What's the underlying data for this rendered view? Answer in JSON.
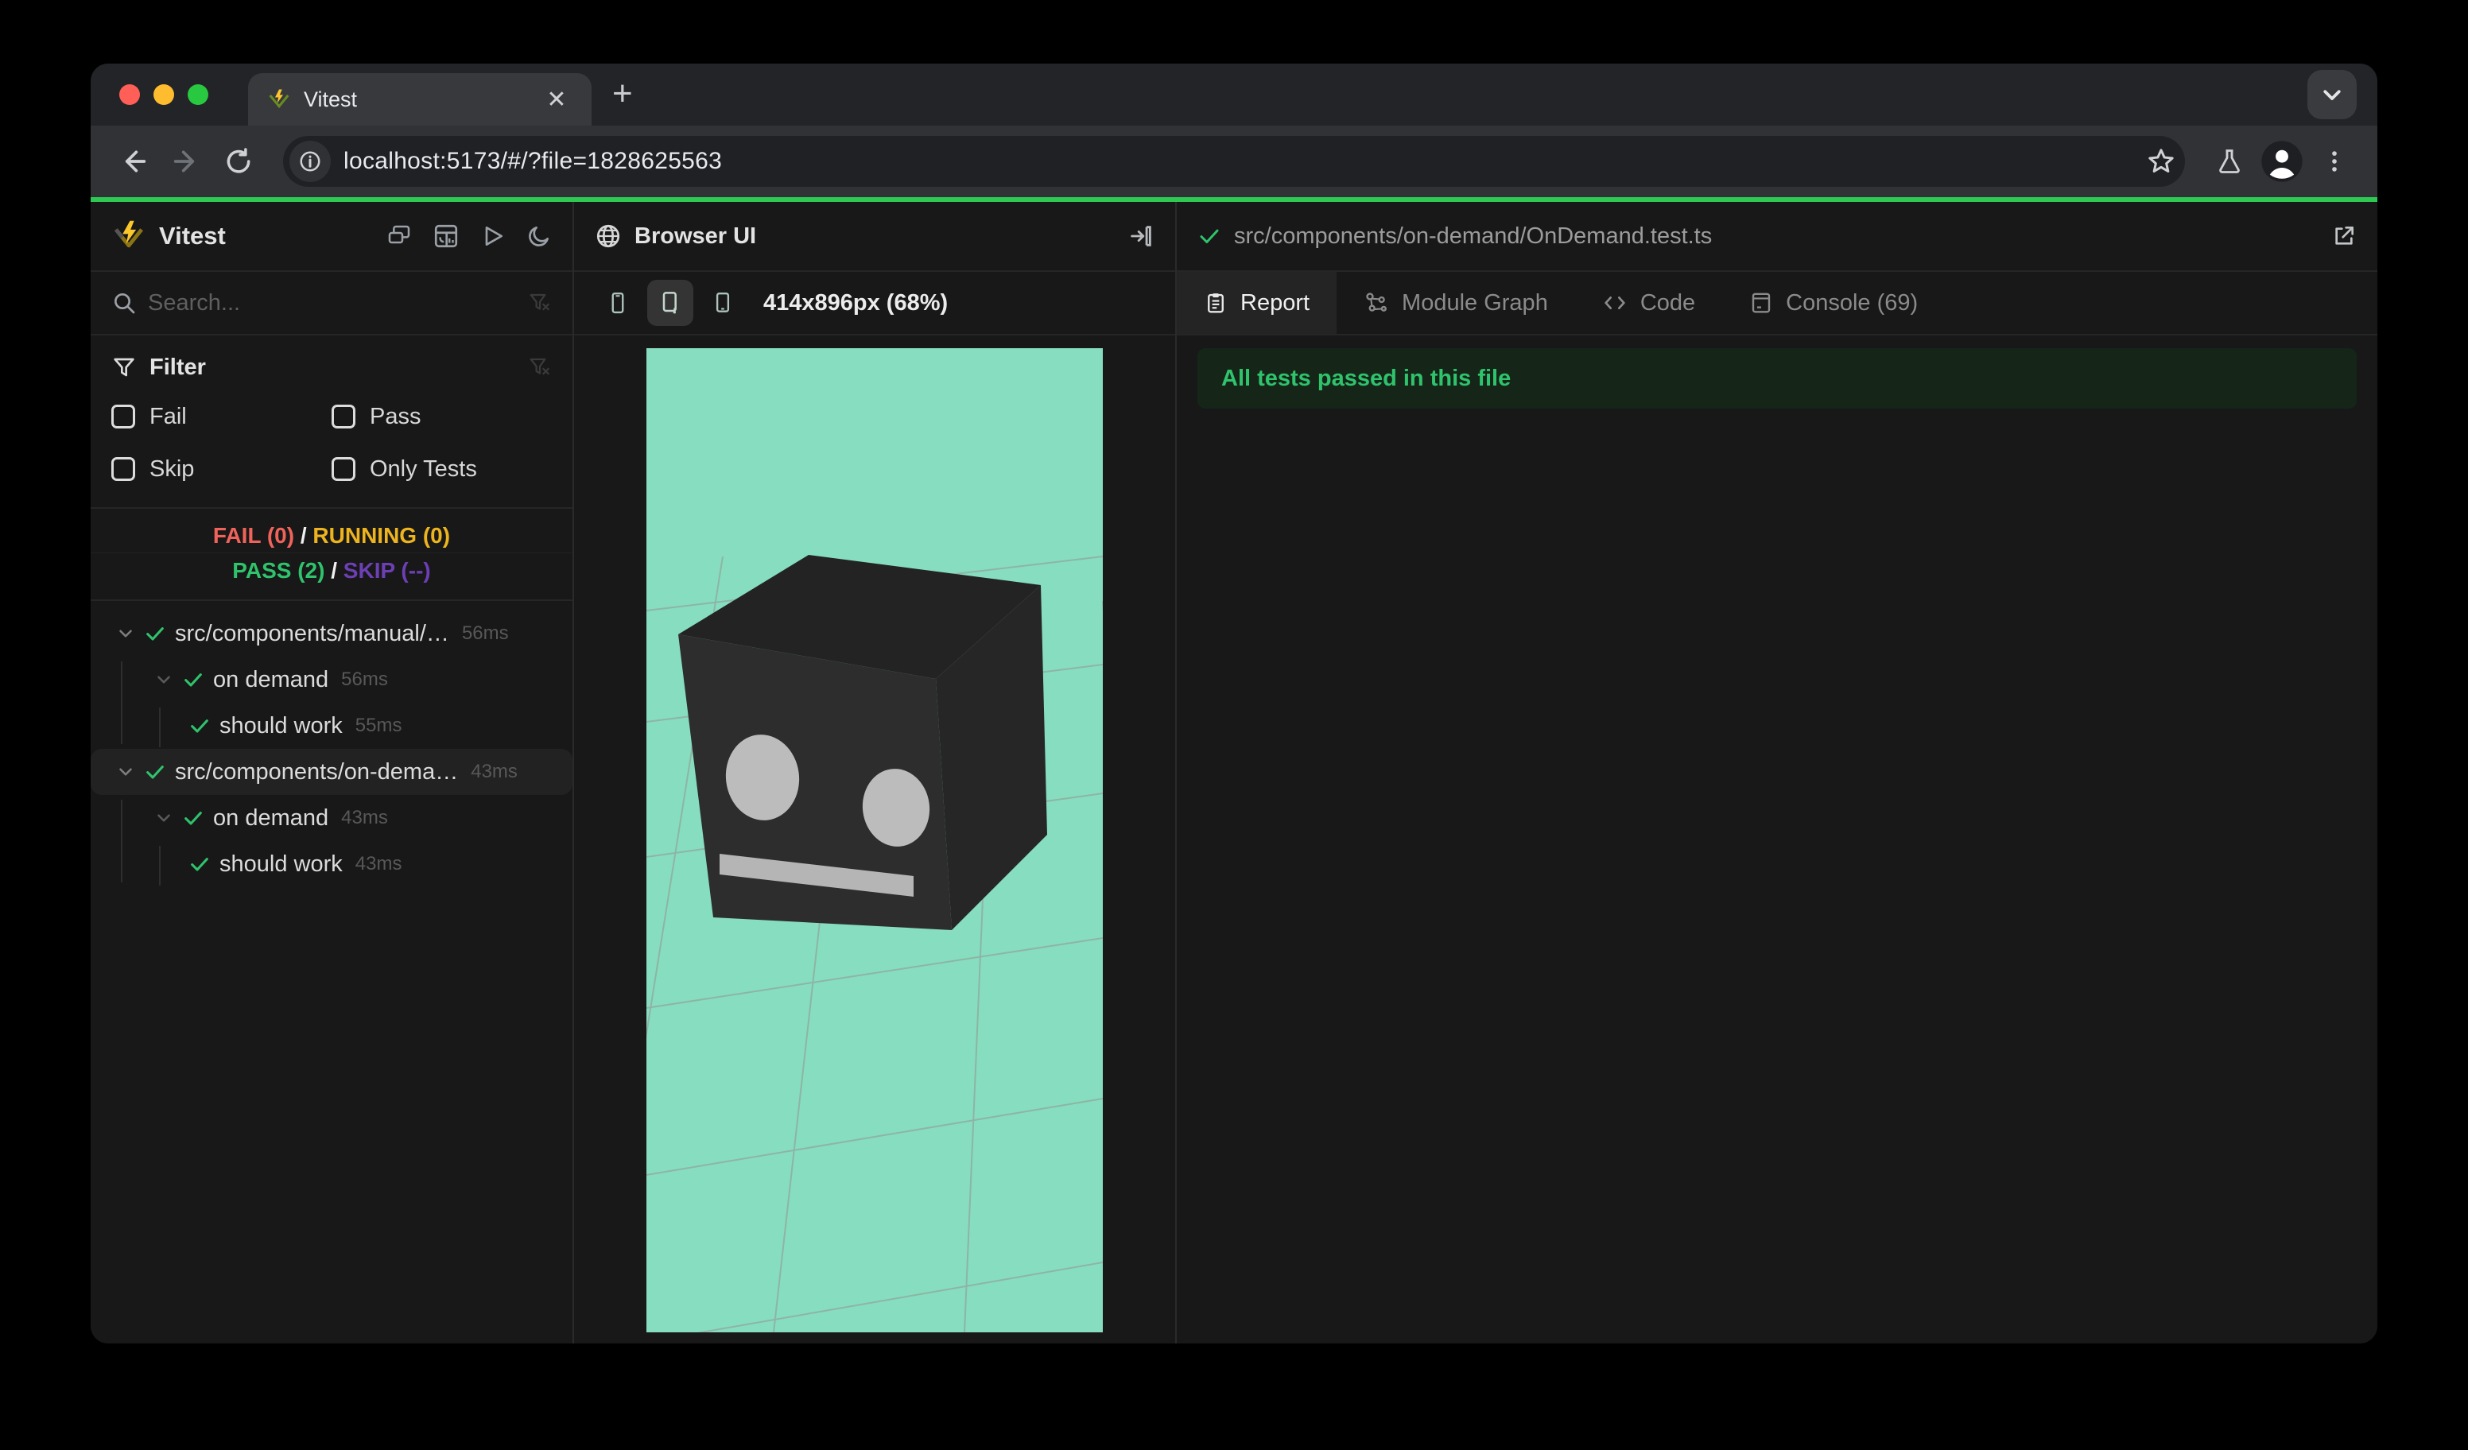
{
  "window": {
    "tab_title": "Vitest",
    "close_glyph": "✕",
    "newtab_glyph": "+",
    "url": "localhost:5173/#/?file=1828625563"
  },
  "sidebar": {
    "title": "Vitest",
    "search_placeholder": "Search...",
    "filter": {
      "title": "Filter",
      "options": [
        {
          "label": "Fail"
        },
        {
          "label": "Pass"
        },
        {
          "label": "Skip"
        },
        {
          "label": "Only Tests"
        }
      ]
    },
    "status": {
      "fail": "FAIL (0)",
      "running": "RUNNING (0)",
      "pass": "PASS (2)",
      "skip": "SKIP (--)",
      "sep": "/"
    },
    "tree": [
      {
        "label": "src/components/manual/…",
        "duration": "56ms",
        "level": 0,
        "chevron": true,
        "selected": false
      },
      {
        "label": "on demand",
        "duration": "56ms",
        "level": 1,
        "chevron": true,
        "selected": false
      },
      {
        "label": "should work",
        "duration": "55ms",
        "level": 2,
        "chevron": false,
        "selected": false
      },
      {
        "label": "src/components/on-dema…",
        "duration": "43ms",
        "level": 0,
        "chevron": true,
        "selected": true
      },
      {
        "label": "on demand",
        "duration": "43ms",
        "level": 1,
        "chevron": true,
        "selected": false
      },
      {
        "label": "should work",
        "duration": "43ms",
        "level": 2,
        "chevron": false,
        "selected": false
      }
    ]
  },
  "preview": {
    "title": "Browser UI",
    "viewport_label": "414x896px (68%)"
  },
  "results": {
    "file": "src/components/on-demand/OnDemand.test.ts",
    "tabs": [
      {
        "label": "Report",
        "icon": "report-icon",
        "active": true
      },
      {
        "label": "Module Graph",
        "icon": "module-graph-icon",
        "active": false
      },
      {
        "label": "Code",
        "icon": "code-icon",
        "active": false
      },
      {
        "label": "Console (69)",
        "icon": "console-icon",
        "active": false
      }
    ],
    "banner": "All tests passed in this file"
  },
  "colors": {
    "accent_green": "#2ec952",
    "pass": "#2fc36c",
    "fail": "#f0635a",
    "running": "#edb41f",
    "skip": "#6d3fb5",
    "preview_bg": "#87ddc0",
    "traffic_red": "#ff5f57",
    "traffic_yellow": "#febc2e",
    "traffic_green": "#28c840"
  }
}
